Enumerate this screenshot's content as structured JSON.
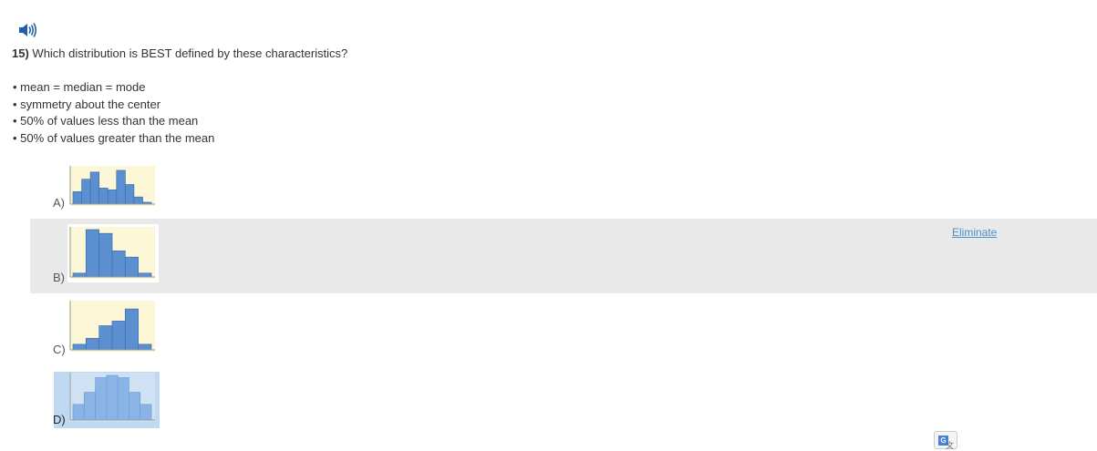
{
  "question": {
    "number": "15)",
    "text": "Which distribution is BEST defined by these characteristics?",
    "bullets": [
      "• mean = median = mode",
      "• symmetry about the center",
      "• 50% of values less than the mean",
      "• 50% of values greater than the mean"
    ]
  },
  "options": [
    {
      "label": "A)",
      "bars": [
        0.35,
        0.7,
        0.9,
        0.45,
        0.4,
        0.95,
        0.55,
        0.2,
        0.05
      ],
      "selected": false
    },
    {
      "label": "B)",
      "bars": [
        0.08,
        1.0,
        0.92,
        0.55,
        0.42,
        0.08
      ],
      "selected": false
    },
    {
      "label": "C)",
      "bars": [
        0.12,
        0.25,
        0.52,
        0.62,
        0.88,
        0.12
      ],
      "selected": false
    },
    {
      "label": "D)",
      "bars": [
        0.35,
        0.62,
        0.95,
        1.0,
        0.95,
        0.62,
        0.35
      ],
      "selected": true
    }
  ],
  "eliminate_label": "Eliminate",
  "colors": {
    "bar": "#5b8fcf",
    "bar_selected": "#8ab3e6",
    "thumb_bg": "#fbf7d7",
    "thumb_bg_selected": "#cfe1f2",
    "highlight_row": "#e9e9e9",
    "link": "#4a90c8"
  },
  "icons": {
    "audio": "speaker-icon",
    "translate": "google-translate-icon"
  },
  "translate_glyph": "G"
}
